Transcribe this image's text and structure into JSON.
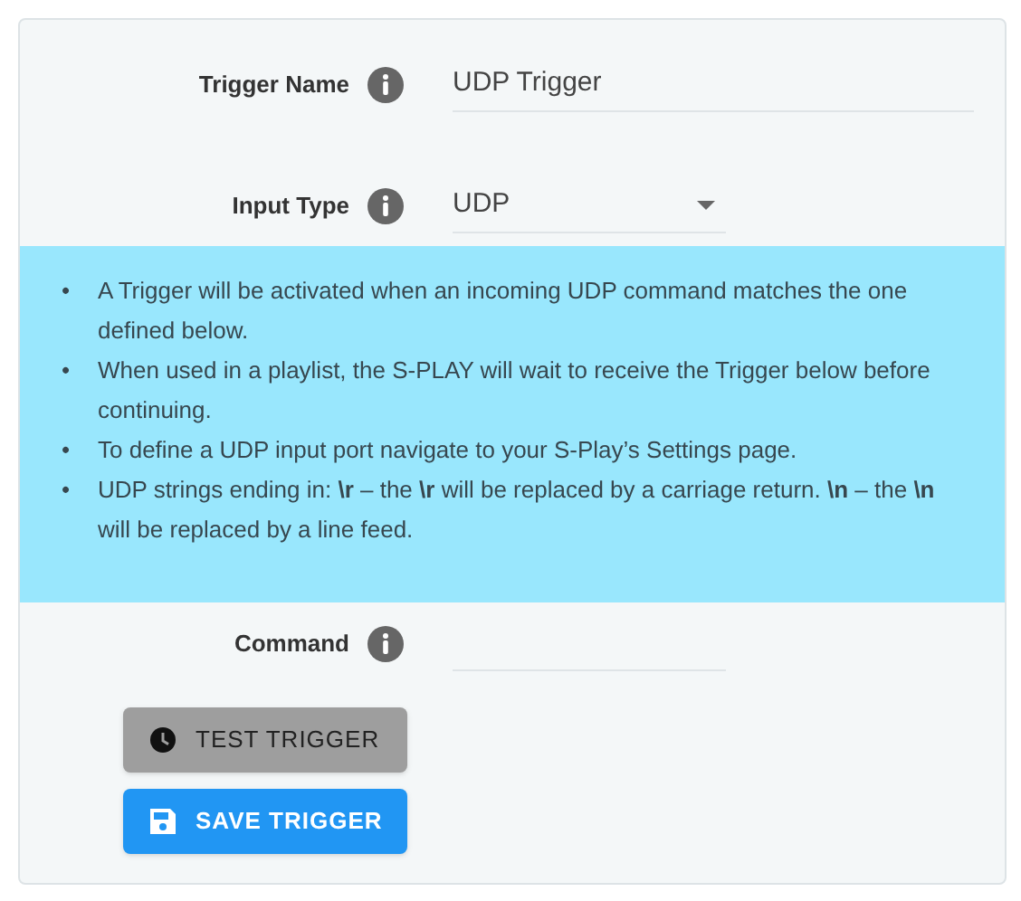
{
  "fields": [
    {
      "label": "Trigger Name",
      "kind": "text",
      "value": "UDP Trigger"
    },
    {
      "label": "Input Type",
      "kind": "select",
      "value": "UDP"
    }
  ],
  "info": [
    {
      "marker": "•",
      "text": "A Trigger will be activated when an incoming UDP command matches the one defined below."
    },
    {
      "marker": "•",
      "text": "When used in a playlist, the S-PLAY will wait to receive the Trigger below before continuing."
    },
    {
      "marker": "•",
      "text": "To define a UDP input port navigate to your S-Play’s Settings page."
    },
    {
      "marker": "•",
      "text": "UDP strings ending in: **\\r** – the **\\r** will be replaced by a carriage return. **\\n** – the **\\n** will be replaced by a line feed."
    }
  ],
  "command": {
    "label": "Command",
    "kind": "text"
  },
  "buttons": [
    {
      "label": "TEST TRIGGER",
      "kind": "test"
    },
    {
      "label": "SAVE TRIGGER",
      "kind": "save"
    }
  ]
}
